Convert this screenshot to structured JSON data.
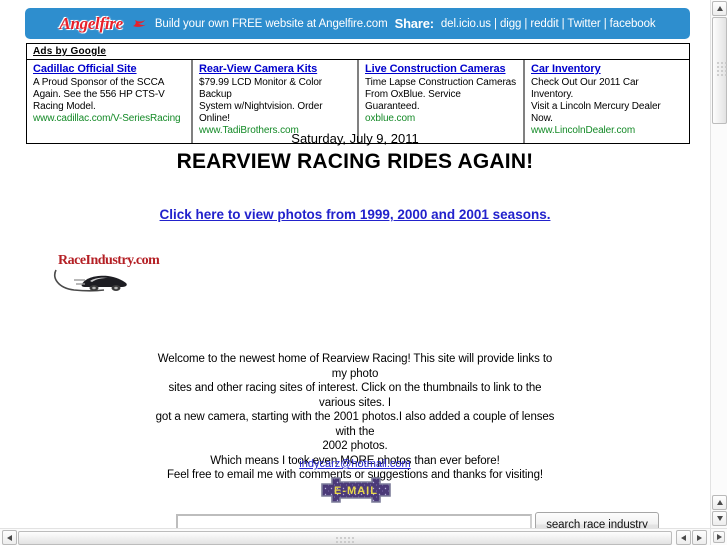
{
  "banner": {
    "logo_text": "Angelfire",
    "logo_icon": "flame-icon",
    "tagline": "Build your own FREE website at Angelfire.com",
    "share_label": "Share:",
    "share_links": "del.icio.us | digg | reddit | Twitter | facebook",
    "background_color": "#2e8ece",
    "logo_color": "#e8202a"
  },
  "ads": {
    "header": "Ads by Google",
    "items": [
      {
        "title": "Cadillac Official Site",
        "line1": "A Proud Sponsor of the SCCA",
        "line2": "Again. See the 556 HP CTS-V",
        "line3": "Racing Model.",
        "url": "www.cadillac.com/V-SeriesRacing"
      },
      {
        "title": "Rear-View Camera Kits",
        "line1": "$79.99 LCD Monitor & Color Backup",
        "line2": "System w/Nightvision. Order Online!",
        "line3": "",
        "url": "www.TadiBrothers.com"
      },
      {
        "title": "Live Construction Cameras",
        "line1": "Time Lapse Construction Cameras",
        "line2": "From OxBlue. Service Guaranteed.",
        "line3": "",
        "url": "oxblue.com"
      },
      {
        "title": "Car Inventory",
        "line1": "Check Out Our 2011 Car Inventory.",
        "line2": "Visit a Lincoln Mercury Dealer Now.",
        "line3": "",
        "url": "www.LincolnDealer.com"
      }
    ]
  },
  "page": {
    "date": "Saturday, July 9, 2011",
    "title": "REARVIEW RACING RIDES AGAIN!",
    "photos_link": "Click here to view photos from 1999, 2000 and 2001 seasons."
  },
  "search": {
    "logo_text": "RaceIndustry.com",
    "logo_color": "#b41f24",
    "input_value": "",
    "input_placeholder": "",
    "button_label": "search race industry"
  },
  "welcome": {
    "line1": "Welcome to the newest home of Rearview Racing! This site will provide links to my photo",
    "line2": "sites and other racing sites of interest. Click on the thumbnails to link to the various sites. I",
    "line3": "got a new camera, starting with the 2001 photos.I also added a couple of lenses with the",
    "line4": "2002 photos.",
    "line5": "Which means I took even MORE photos than ever before!",
    "line6": "Feel free to email me with comments or suggestions and thanks for visiting!"
  },
  "email": {
    "address": "indycarz@hotmail.com",
    "image_label": "E-MAIL"
  },
  "scrollbars": {
    "vertical_up": "scroll-up",
    "vertical_down": "scroll-down",
    "horizontal_left": "scroll-left",
    "horizontal_right": "scroll-right"
  }
}
